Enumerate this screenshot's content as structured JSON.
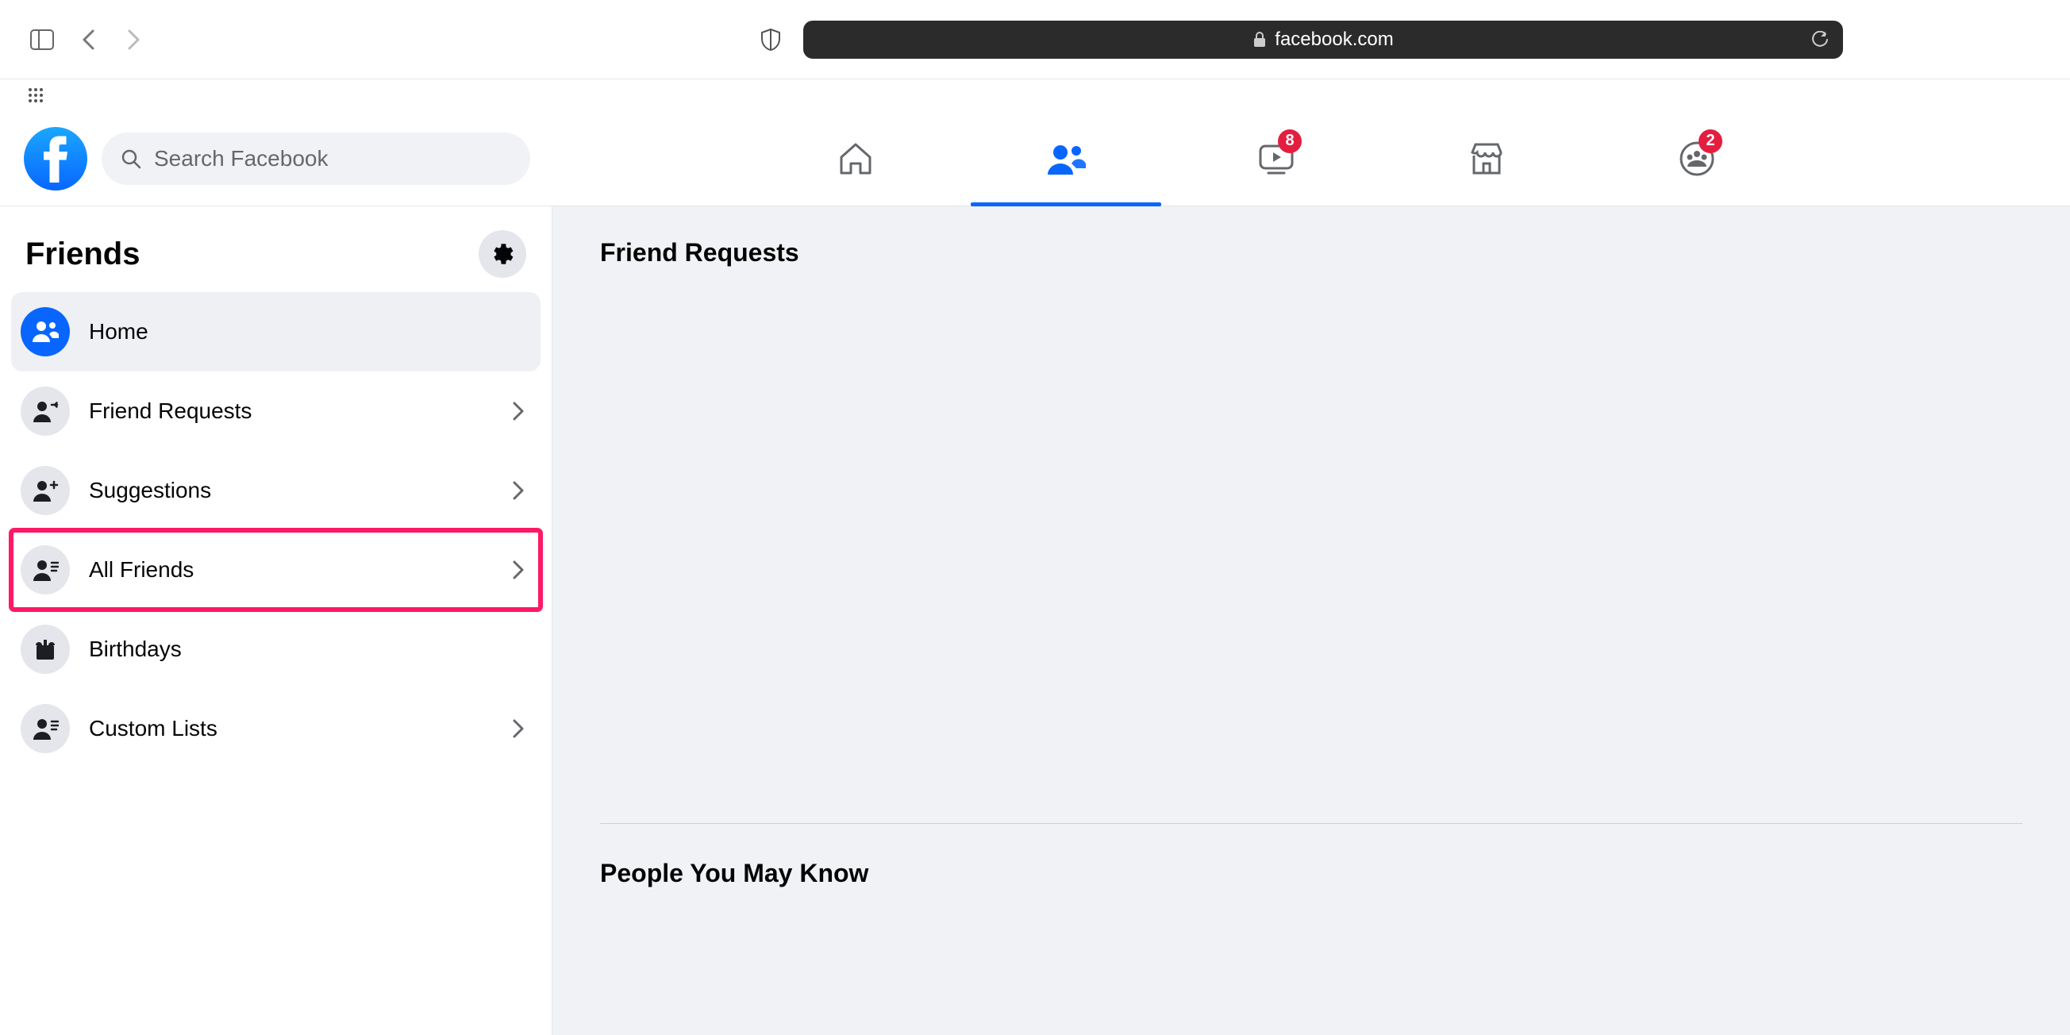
{
  "browser": {
    "url": "facebook.com"
  },
  "search": {
    "placeholder": "Search Facebook"
  },
  "nav": {
    "watch_badge": "8",
    "groups_badge": "2"
  },
  "sidebar": {
    "title": "Friends",
    "items": [
      {
        "label": "Home"
      },
      {
        "label": "Friend Requests"
      },
      {
        "label": "Suggestions"
      },
      {
        "label": "All Friends"
      },
      {
        "label": "Birthdays"
      },
      {
        "label": "Custom Lists"
      }
    ]
  },
  "content": {
    "section1_title": "Friend Requests",
    "section2_title": "People You May Know"
  }
}
